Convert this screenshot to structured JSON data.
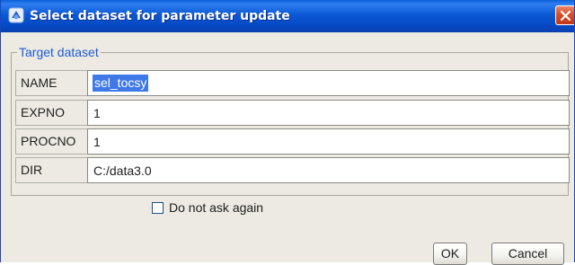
{
  "window": {
    "title": "Select dataset for parameter update",
    "icon": "topspin-app-icon",
    "close_icon": "close-icon"
  },
  "group": {
    "title": "Target dataset"
  },
  "fields": [
    {
      "label": "NAME",
      "value": "sel_tocsy",
      "selected": true
    },
    {
      "label": "EXPNO",
      "value": "1"
    },
    {
      "label": "PROCNO",
      "value": "1"
    },
    {
      "label": "DIR",
      "value": "C:/data3.0"
    }
  ],
  "checkbox": {
    "label": "Do not ask again",
    "checked": false
  },
  "buttons": {
    "ok_label": "OK",
    "cancel_label": "Cancel"
  },
  "colors": {
    "titlebar": "#0a59d4",
    "selection": "#3f79e8",
    "group_title": "#1d5bd6",
    "close_button": "#d8502c"
  }
}
